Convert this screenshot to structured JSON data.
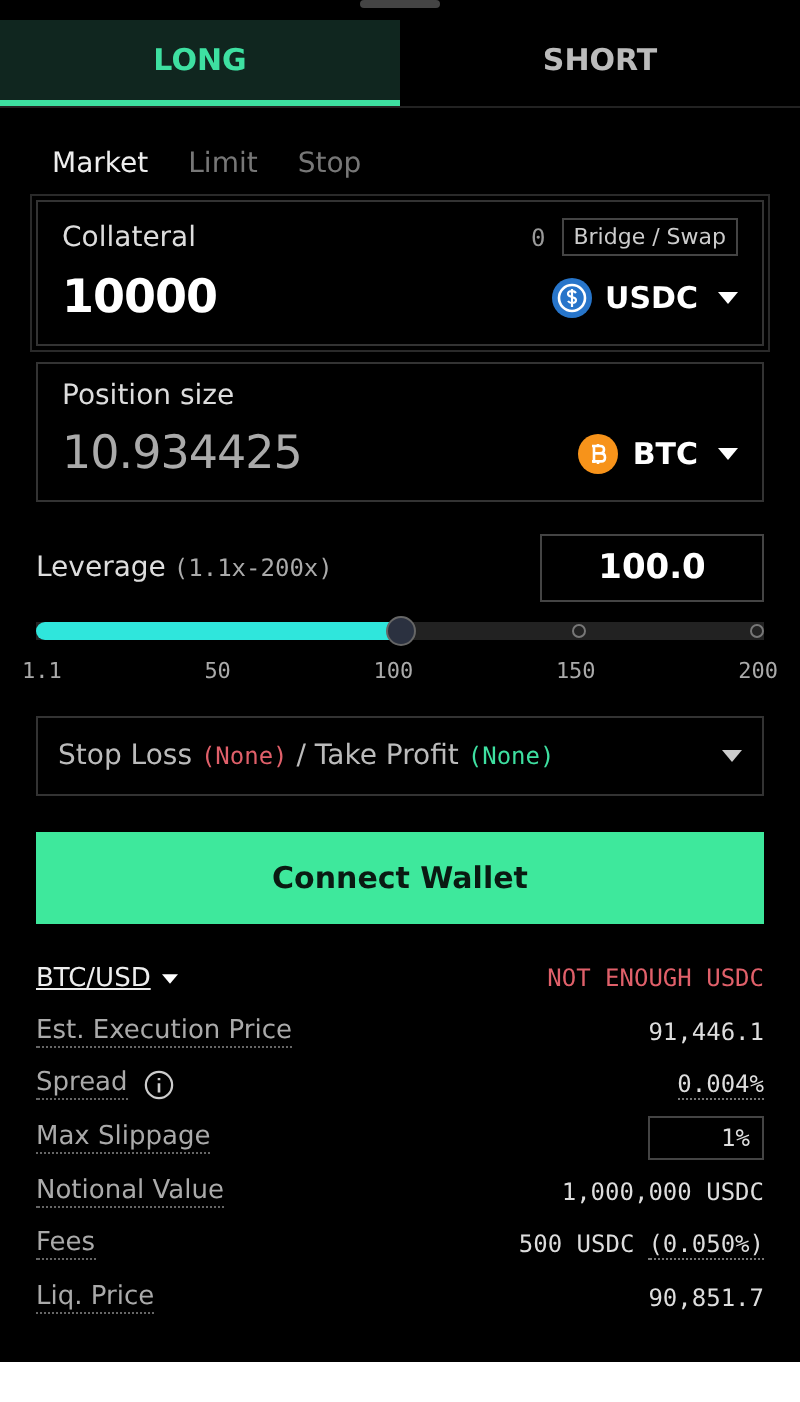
{
  "tabs": [
    {
      "label": "LONG",
      "selected": true
    },
    {
      "label": "SHORT",
      "selected": false
    }
  ],
  "order_types": [
    {
      "label": "Market",
      "selected": true
    },
    {
      "label": "Limit",
      "selected": false
    },
    {
      "label": "Stop",
      "selected": false
    }
  ],
  "collateral": {
    "label": "Collateral",
    "balance": "0",
    "bridge_button": "Bridge / Swap",
    "value": "10000",
    "token": "USDC"
  },
  "position_size": {
    "label": "Position size",
    "value": "10.934425",
    "token": "BTC"
  },
  "leverage": {
    "label": "Leverage",
    "range": "(1.1x-200x)",
    "value": "100.0",
    "level": 0.5,
    "ticks": [
      "1.1",
      "50",
      "100",
      "150",
      "200"
    ]
  },
  "stop_take": {
    "stop_label": "Stop Loss",
    "stop_value": "(None)",
    "separator": "/ Take Profit",
    "take_value": "(None)"
  },
  "connect_button": "Connect Wallet",
  "market": {
    "pair": "BTC/USD",
    "warning": "NOT ENOUGH USDC"
  },
  "details": [
    {
      "label": "Est. Execution Price",
      "info": false,
      "kind": "text",
      "value": "91,446.1"
    },
    {
      "label": "Spread",
      "info": true,
      "kind": "underlined",
      "value": "0.004%"
    },
    {
      "label": "Max Slippage",
      "info": false,
      "kind": "input",
      "value": "1%"
    },
    {
      "label": "Notional Value",
      "info": false,
      "kind": "text",
      "value": "1,000,000 USDC"
    },
    {
      "label": "Fees",
      "info": false,
      "kind": "split",
      "value": "500 USDC",
      "extra": "(0.050%)"
    },
    {
      "label": "Liq. Price",
      "info": false,
      "kind": "text",
      "value": "90,851.7"
    }
  ]
}
